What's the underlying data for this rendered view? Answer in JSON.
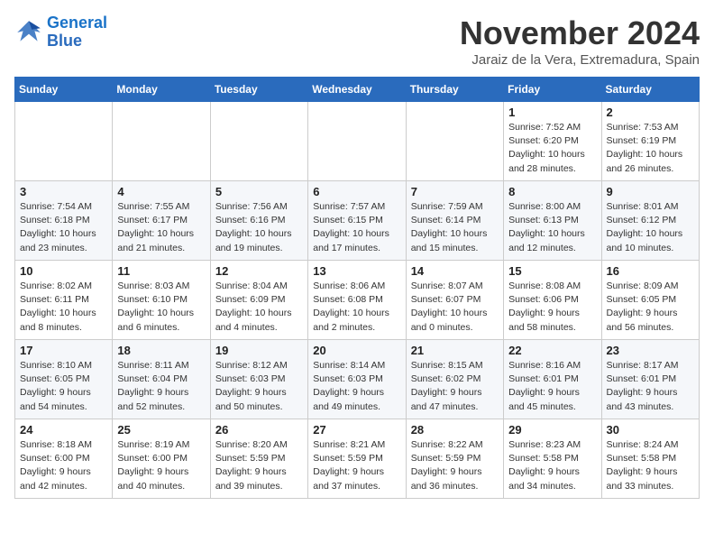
{
  "header": {
    "logo_line1": "General",
    "logo_line2": "Blue",
    "month": "November 2024",
    "location": "Jaraiz de la Vera, Extremadura, Spain"
  },
  "weekdays": [
    "Sunday",
    "Monday",
    "Tuesday",
    "Wednesday",
    "Thursday",
    "Friday",
    "Saturday"
  ],
  "weeks": [
    [
      {
        "day": "",
        "info": ""
      },
      {
        "day": "",
        "info": ""
      },
      {
        "day": "",
        "info": ""
      },
      {
        "day": "",
        "info": ""
      },
      {
        "day": "",
        "info": ""
      },
      {
        "day": "1",
        "info": "Sunrise: 7:52 AM\nSunset: 6:20 PM\nDaylight: 10 hours and 28 minutes."
      },
      {
        "day": "2",
        "info": "Sunrise: 7:53 AM\nSunset: 6:19 PM\nDaylight: 10 hours and 26 minutes."
      }
    ],
    [
      {
        "day": "3",
        "info": "Sunrise: 7:54 AM\nSunset: 6:18 PM\nDaylight: 10 hours and 23 minutes."
      },
      {
        "day": "4",
        "info": "Sunrise: 7:55 AM\nSunset: 6:17 PM\nDaylight: 10 hours and 21 minutes."
      },
      {
        "day": "5",
        "info": "Sunrise: 7:56 AM\nSunset: 6:16 PM\nDaylight: 10 hours and 19 minutes."
      },
      {
        "day": "6",
        "info": "Sunrise: 7:57 AM\nSunset: 6:15 PM\nDaylight: 10 hours and 17 minutes."
      },
      {
        "day": "7",
        "info": "Sunrise: 7:59 AM\nSunset: 6:14 PM\nDaylight: 10 hours and 15 minutes."
      },
      {
        "day": "8",
        "info": "Sunrise: 8:00 AM\nSunset: 6:13 PM\nDaylight: 10 hours and 12 minutes."
      },
      {
        "day": "9",
        "info": "Sunrise: 8:01 AM\nSunset: 6:12 PM\nDaylight: 10 hours and 10 minutes."
      }
    ],
    [
      {
        "day": "10",
        "info": "Sunrise: 8:02 AM\nSunset: 6:11 PM\nDaylight: 10 hours and 8 minutes."
      },
      {
        "day": "11",
        "info": "Sunrise: 8:03 AM\nSunset: 6:10 PM\nDaylight: 10 hours and 6 minutes."
      },
      {
        "day": "12",
        "info": "Sunrise: 8:04 AM\nSunset: 6:09 PM\nDaylight: 10 hours and 4 minutes."
      },
      {
        "day": "13",
        "info": "Sunrise: 8:06 AM\nSunset: 6:08 PM\nDaylight: 10 hours and 2 minutes."
      },
      {
        "day": "14",
        "info": "Sunrise: 8:07 AM\nSunset: 6:07 PM\nDaylight: 10 hours and 0 minutes."
      },
      {
        "day": "15",
        "info": "Sunrise: 8:08 AM\nSunset: 6:06 PM\nDaylight: 9 hours and 58 minutes."
      },
      {
        "day": "16",
        "info": "Sunrise: 8:09 AM\nSunset: 6:05 PM\nDaylight: 9 hours and 56 minutes."
      }
    ],
    [
      {
        "day": "17",
        "info": "Sunrise: 8:10 AM\nSunset: 6:05 PM\nDaylight: 9 hours and 54 minutes."
      },
      {
        "day": "18",
        "info": "Sunrise: 8:11 AM\nSunset: 6:04 PM\nDaylight: 9 hours and 52 minutes."
      },
      {
        "day": "19",
        "info": "Sunrise: 8:12 AM\nSunset: 6:03 PM\nDaylight: 9 hours and 50 minutes."
      },
      {
        "day": "20",
        "info": "Sunrise: 8:14 AM\nSunset: 6:03 PM\nDaylight: 9 hours and 49 minutes."
      },
      {
        "day": "21",
        "info": "Sunrise: 8:15 AM\nSunset: 6:02 PM\nDaylight: 9 hours and 47 minutes."
      },
      {
        "day": "22",
        "info": "Sunrise: 8:16 AM\nSunset: 6:01 PM\nDaylight: 9 hours and 45 minutes."
      },
      {
        "day": "23",
        "info": "Sunrise: 8:17 AM\nSunset: 6:01 PM\nDaylight: 9 hours and 43 minutes."
      }
    ],
    [
      {
        "day": "24",
        "info": "Sunrise: 8:18 AM\nSunset: 6:00 PM\nDaylight: 9 hours and 42 minutes."
      },
      {
        "day": "25",
        "info": "Sunrise: 8:19 AM\nSunset: 6:00 PM\nDaylight: 9 hours and 40 minutes."
      },
      {
        "day": "26",
        "info": "Sunrise: 8:20 AM\nSunset: 5:59 PM\nDaylight: 9 hours and 39 minutes."
      },
      {
        "day": "27",
        "info": "Sunrise: 8:21 AM\nSunset: 5:59 PM\nDaylight: 9 hours and 37 minutes."
      },
      {
        "day": "28",
        "info": "Sunrise: 8:22 AM\nSunset: 5:59 PM\nDaylight: 9 hours and 36 minutes."
      },
      {
        "day": "29",
        "info": "Sunrise: 8:23 AM\nSunset: 5:58 PM\nDaylight: 9 hours and 34 minutes."
      },
      {
        "day": "30",
        "info": "Sunrise: 8:24 AM\nSunset: 5:58 PM\nDaylight: 9 hours and 33 minutes."
      }
    ]
  ]
}
